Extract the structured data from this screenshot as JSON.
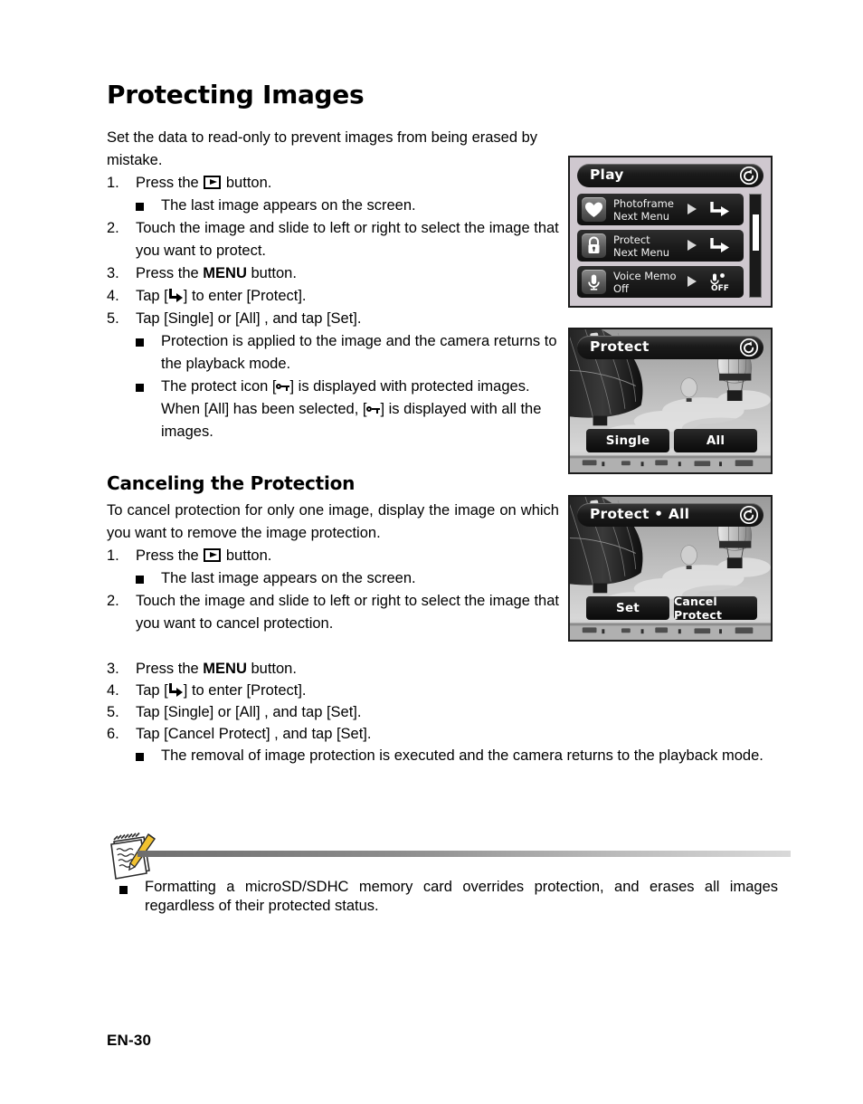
{
  "page": {
    "title": "Protecting Images",
    "folio": "EN-30"
  },
  "intro": "Set the data to read-only to prevent images from being erased by mistake.",
  "steps_protect": [
    {
      "num": "1.",
      "pre": "Press the ",
      "icon": "playback-icon",
      "post": " button."
    },
    {
      "num": "2.",
      "text": "Touch the image and slide to left or right to  select the image that you want to protect."
    },
    {
      "num": "3.",
      "pre": "Press the ",
      "bold": "MENU",
      "post": " button."
    },
    {
      "num": "4.",
      "pre": "Tap [",
      "icon": "enter-arrow-icon",
      "post": "] to enter [Protect]."
    },
    {
      "num": "5.",
      "text": "Tap [Single] or [All] , and tap [Set]."
    }
  ],
  "bullets_protect": {
    "first": "The last image appears on the screen.",
    "applied": "Protection is applied to the image and the camera returns to the playback mode.",
    "icon_line_pre": "The protect icon [",
    "icon_line_post": "] is displayed with protected images.",
    "all_line_pre": "When [All] has been selected, [",
    "all_line_post": "] is displayed with all the images."
  },
  "section2": {
    "heading": "Canceling the Protection",
    "intro": "To cancel protection for only one image, display the image on which you want to remove the image protection.",
    "steps": [
      {
        "num": "1.",
        "pre": "Press the ",
        "icon": "playback-icon",
        "post": " button."
      },
      {
        "num": "2.",
        "text": "Touch the image and slide to left or right to  select the image that you want to cancel protection."
      },
      {
        "num": "3.",
        "pre": "Press the ",
        "bold": "MENU",
        "post": " button."
      },
      {
        "num": "4.",
        "pre": "Tap [",
        "icon": "enter-arrow-icon",
        "post": "] to enter [Protect]."
      },
      {
        "num": "5.",
        "text": "Tap [Single] or [All] , and tap [Set]."
      },
      {
        "num": "6.",
        "text": "Tap [Cancel Protect] , and tap [Set]."
      }
    ],
    "bullet_first": "The last image appears on the screen.",
    "bullet_removal": "The removal of image protection is executed and the camera returns to the playback mode."
  },
  "note": {
    "icon": "notepad-pencil-icon",
    "bullet": "Formatting a microSD/SDHC memory card  overrides protection, and erases all images regardless of their protected status."
  },
  "screens": {
    "play_menu": {
      "title": "Play",
      "back_icon": "return-arrow-icon",
      "rows": [
        {
          "icon": "heart-icon",
          "label": "Photoframe",
          "value": "Next Menu",
          "arrow": "right-triangle-icon",
          "action": "enter-arrow-icon"
        },
        {
          "icon": "padlock-icon",
          "label": "Protect",
          "value": "Next Menu",
          "arrow": "right-triangle-icon",
          "action": "enter-arrow-icon"
        },
        {
          "icon": "microphone-icon",
          "label": "Voice Memo",
          "value": "Off",
          "arrow": "right-triangle-icon",
          "action": "mic-off-icon"
        }
      ],
      "scrollbar": "vertical-scrollbar"
    },
    "protect": {
      "title": "Protect",
      "back_icon": "return-arrow-icon",
      "photo": "hot-air-balloons-photo",
      "buttons": [
        "Single",
        "All"
      ]
    },
    "protect_all": {
      "title": "Protect • All",
      "back_icon": "return-arrow-icon",
      "photo": "hot-air-balloons-photo",
      "buttons": [
        "Set",
        "Cancel Protect"
      ]
    }
  },
  "colors": {
    "page_bg": "#ffffff",
    "text": "#000000",
    "screen_bezel": "#1b1b1b",
    "screen_bg": "#cfc8cf",
    "menu_row": "#1c1c1c",
    "pencil_yellow": "#f2c230"
  }
}
